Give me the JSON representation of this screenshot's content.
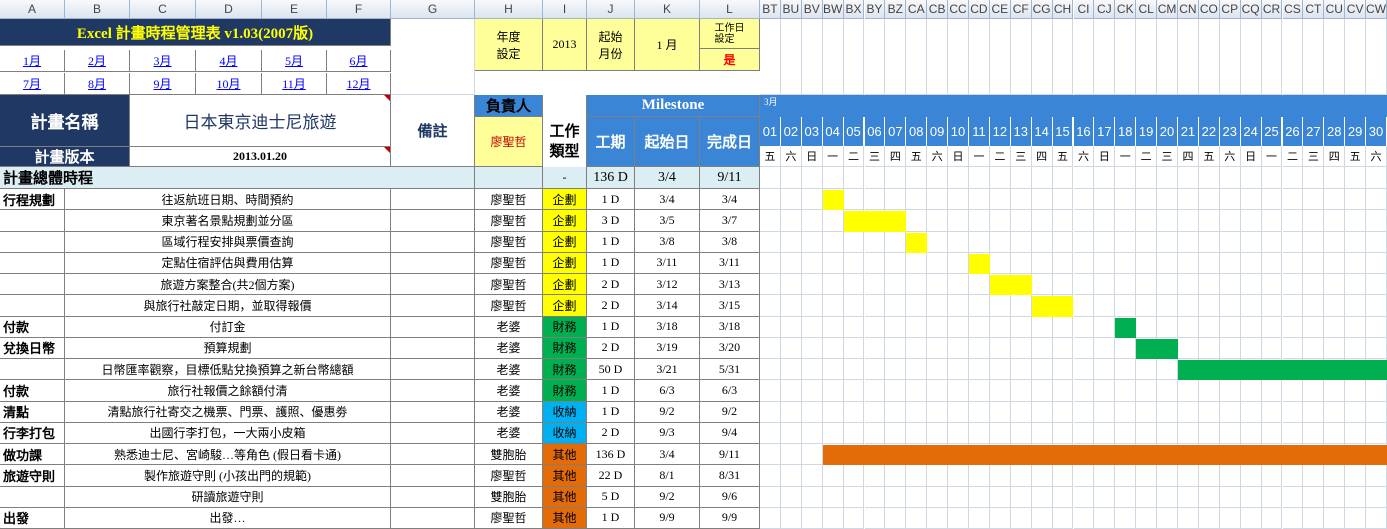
{
  "columns": [
    "A",
    "B",
    "C",
    "D",
    "E",
    "F",
    "G",
    "H",
    "I",
    "J",
    "K",
    "L"
  ],
  "gantt_columns": [
    "BT",
    "BU",
    "BV",
    "BW",
    "BX",
    "BY",
    "BZ",
    "CA",
    "CB",
    "CC",
    "CD",
    "CE",
    "CF",
    "CG",
    "CH",
    "CI",
    "CJ",
    "CK",
    "CL",
    "CM",
    "CN",
    "CO",
    "CP",
    "CQ",
    "CR",
    "CS",
    "CT",
    "CU",
    "CV",
    "CW"
  ],
  "title": "Excel 計畫時程管理表 v1.03(2007版)",
  "months": [
    "1月",
    "2月",
    "3月",
    "4月",
    "5月",
    "6月",
    "7月",
    "8月",
    "9月",
    "10月",
    "11月",
    "12月"
  ],
  "settings": {
    "year_label": "年度\n設定",
    "year_value": "2013",
    "start_month_label": "起始\n月份",
    "start_month_value": "1 月",
    "workday_label": "工作日\n設定",
    "workday_value": "是"
  },
  "project": {
    "name_label": "計畫名稱",
    "name_value": "日本東京迪士尼旅遊",
    "version_label": "計畫版本",
    "version_value": "2013.01.20",
    "notes_label": "備註",
    "summary_label": "計畫總體時程"
  },
  "headers": {
    "owner": "負責人",
    "owner_value": "廖聖哲",
    "type": "工作\n類型",
    "milestone": "Milestone",
    "duration": "工期",
    "start": "起始日",
    "end": "完成日"
  },
  "summary": {
    "type": "-",
    "duration": "136 D",
    "start": "3/4",
    "end": "9/11"
  },
  "gantt": {
    "month_label": "3月",
    "days": [
      "01",
      "02",
      "03",
      "04",
      "05",
      "06",
      "07",
      "08",
      "09",
      "10",
      "11",
      "12",
      "13",
      "14",
      "15",
      "16",
      "17",
      "18",
      "19",
      "20",
      "21",
      "22",
      "23",
      "24",
      "25",
      "26",
      "27",
      "28",
      "29",
      "30"
    ],
    "weekdays": [
      "五",
      "六",
      "日",
      "一",
      "二",
      "三",
      "四",
      "五",
      "六",
      "日",
      "一",
      "二",
      "三",
      "四",
      "五",
      "六",
      "日",
      "一",
      "二",
      "三",
      "四",
      "五",
      "六",
      "日",
      "一",
      "二",
      "三",
      "四",
      "五",
      "六"
    ]
  },
  "colors": {
    "plan": "#ffff00",
    "finance": "#00b050",
    "receive": "#00b0f0",
    "other": "#e36c09",
    "navy": "#1f3864",
    "blue": "#3a85d6"
  },
  "tasks": [
    {
      "category": "行程規劃",
      "task": "往返航班日期、時間預約",
      "owner": "廖聖哲",
      "type": "企劃",
      "duration": "1 D",
      "start": "3/4",
      "end": "3/4",
      "bar_start_day": 4,
      "bar_end_day": 4
    },
    {
      "category": "",
      "task": "東京著名景點規劃並分區",
      "owner": "廖聖哲",
      "type": "企劃",
      "duration": "3 D",
      "start": "3/5",
      "end": "3/7",
      "bar_start_day": 5,
      "bar_end_day": 7
    },
    {
      "category": "",
      "task": "區域行程安排與票價查詢",
      "owner": "廖聖哲",
      "type": "企劃",
      "duration": "1 D",
      "start": "3/8",
      "end": "3/8",
      "bar_start_day": 8,
      "bar_end_day": 8
    },
    {
      "category": "",
      "task": "定點住宿評估與費用估算",
      "owner": "廖聖哲",
      "type": "企劃",
      "duration": "1 D",
      "start": "3/11",
      "end": "3/11",
      "bar_start_day": 11,
      "bar_end_day": 11
    },
    {
      "category": "",
      "task": "旅遊方案整合(共2個方案)",
      "owner": "廖聖哲",
      "type": "企劃",
      "duration": "2 D",
      "start": "3/12",
      "end": "3/13",
      "bar_start_day": 12,
      "bar_end_day": 13
    },
    {
      "category": "",
      "task": "與旅行社敲定日期，並取得報價",
      "owner": "廖聖哲",
      "type": "企劃",
      "duration": "2 D",
      "start": "3/14",
      "end": "3/15",
      "bar_start_day": 14,
      "bar_end_day": 15
    },
    {
      "category": "付款",
      "task": "付訂金",
      "owner": "老婆",
      "type": "財務",
      "duration": "1 D",
      "start": "3/18",
      "end": "3/18",
      "bar_start_day": 18,
      "bar_end_day": 18
    },
    {
      "category": "兌換日幣",
      "task": "預算規劃",
      "owner": "老婆",
      "type": "財務",
      "duration": "2 D",
      "start": "3/19",
      "end": "3/20",
      "bar_start_day": 19,
      "bar_end_day": 20
    },
    {
      "category": "",
      "task": "日幣匯率觀察，目標低點兌換預算之新台幣總額",
      "owner": "老婆",
      "type": "財務",
      "duration": "50 D",
      "start": "3/21",
      "end": "5/31",
      "bar_start_day": 21,
      "bar_end_day": 30
    },
    {
      "category": "付款",
      "task": "旅行社報價之餘額付清",
      "owner": "老婆",
      "type": "財務",
      "duration": "1 D",
      "start": "6/3",
      "end": "6/3"
    },
    {
      "category": "清點",
      "task": "清點旅行社寄交之機票、門票、護照、優惠劵",
      "owner": "老婆",
      "type": "收納",
      "duration": "1 D",
      "start": "9/2",
      "end": "9/2"
    },
    {
      "category": "行李打包",
      "task": "出國行李打包，一大兩小皮箱",
      "owner": "老婆",
      "type": "收納",
      "duration": "2 D",
      "start": "9/3",
      "end": "9/4"
    },
    {
      "category": "做功課",
      "task": "熟悉迪士尼、宮崎駿…等角色 (假日看卡通)",
      "owner": "雙胞胎",
      "type": "其他",
      "duration": "136 D",
      "start": "3/4",
      "end": "9/11",
      "bar_start_day": 4,
      "bar_end_day": 30
    },
    {
      "category": "旅遊守則",
      "task": "製作旅遊守則 (小孩出門的規範)",
      "owner": "廖聖哲",
      "type": "其他",
      "duration": "22 D",
      "start": "8/1",
      "end": "8/31"
    },
    {
      "category": "",
      "task": "研讀旅遊守則",
      "owner": "雙胞胎",
      "type": "其他",
      "duration": "5 D",
      "start": "9/2",
      "end": "9/6"
    },
    {
      "category": "出發",
      "task": "出發…",
      "owner": "廖聖哲",
      "type": "其他",
      "duration": "1 D",
      "start": "9/9",
      "end": "9/9"
    }
  ]
}
